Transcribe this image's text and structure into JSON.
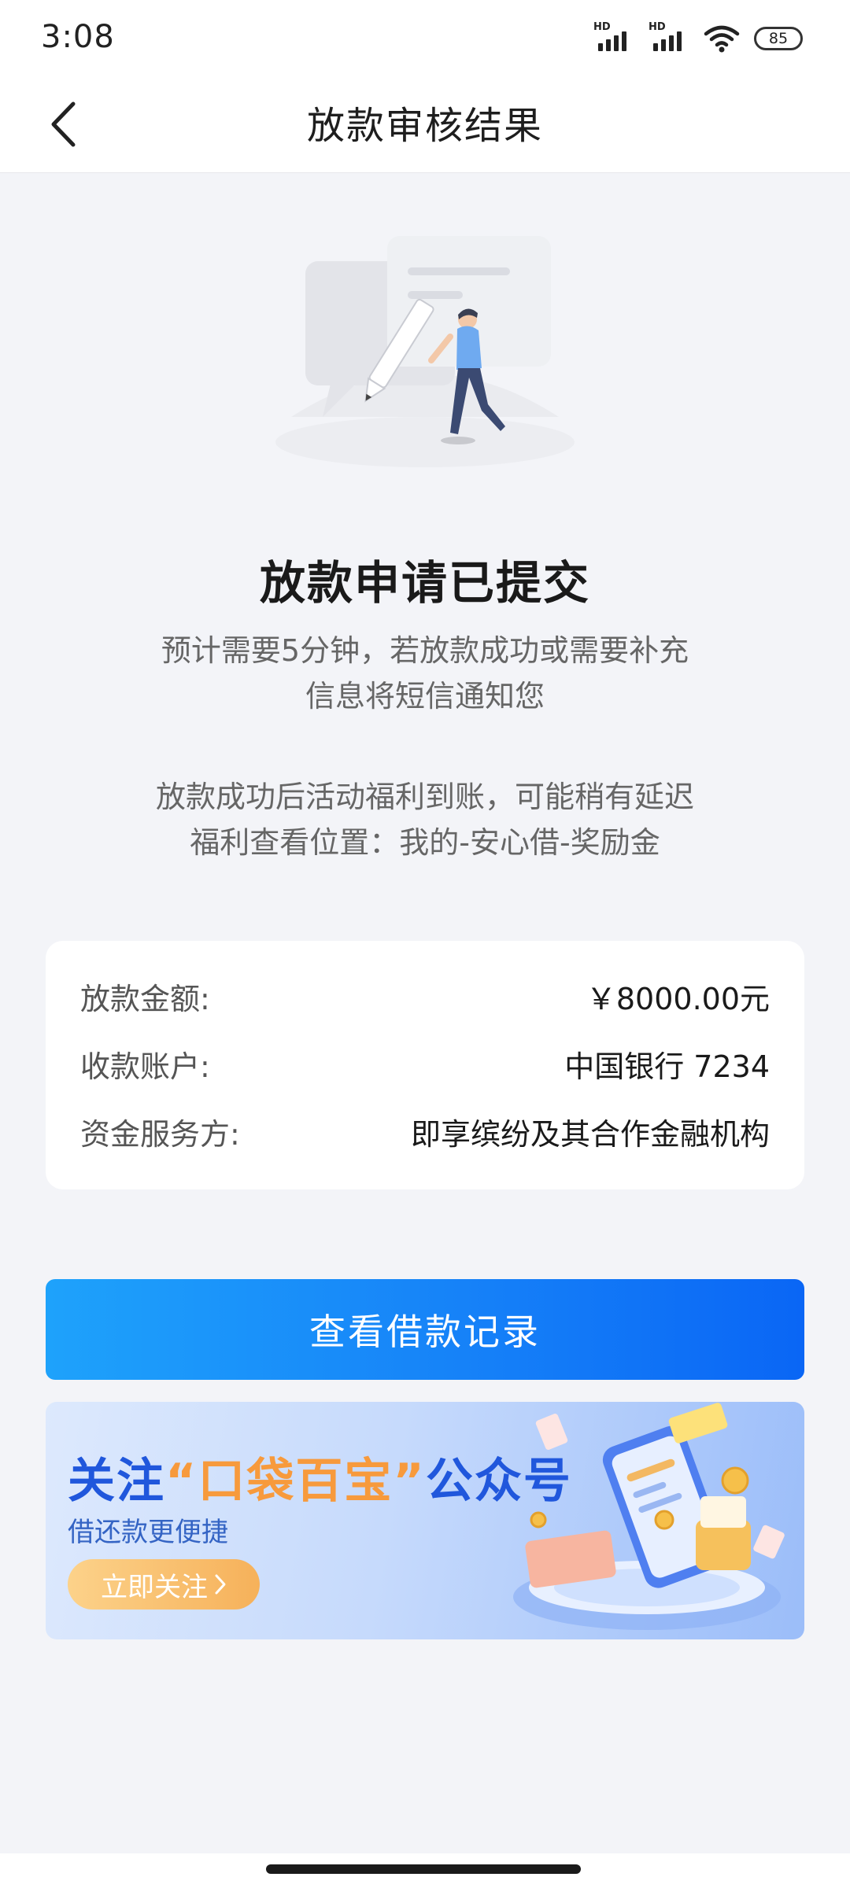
{
  "status_bar": {
    "time": "3:08",
    "signal_1_tag": "HD",
    "signal_2_tag": "HD",
    "battery": "85"
  },
  "nav": {
    "title": "放款审核结果",
    "back_icon": "chevron-left-icon"
  },
  "result": {
    "headline": "放款申请已提交",
    "desc_line1": "预计需要5分钟，若放款成功或需要补充",
    "desc_line2": "信息将短信通知您",
    "notice_line1": "放款成功后活动福利到账，可能稍有延迟",
    "notice_line2": "福利查看位置：我的-安心借-奖励金"
  },
  "details": [
    {
      "label": "放款金额:",
      "value": "￥8000.00元"
    },
    {
      "label": "收款账户:",
      "value": "中国银行 7234"
    },
    {
      "label": "资金服务方:",
      "value": "即享缤纷及其合作金融机构"
    }
  ],
  "primary_button": "查看借款记录",
  "promo": {
    "title_prefix": "关注",
    "title_highlight": "“口袋百宝”",
    "title_suffix": "公众号",
    "subtitle": "借还款更便捷",
    "button": "立即关注",
    "button_icon": "chevron-right-icon"
  },
  "colors": {
    "primary": "#1682f8",
    "background": "#f3f4f8",
    "promo_title": "#2057dc",
    "promo_highlight": "#f79a3c"
  }
}
